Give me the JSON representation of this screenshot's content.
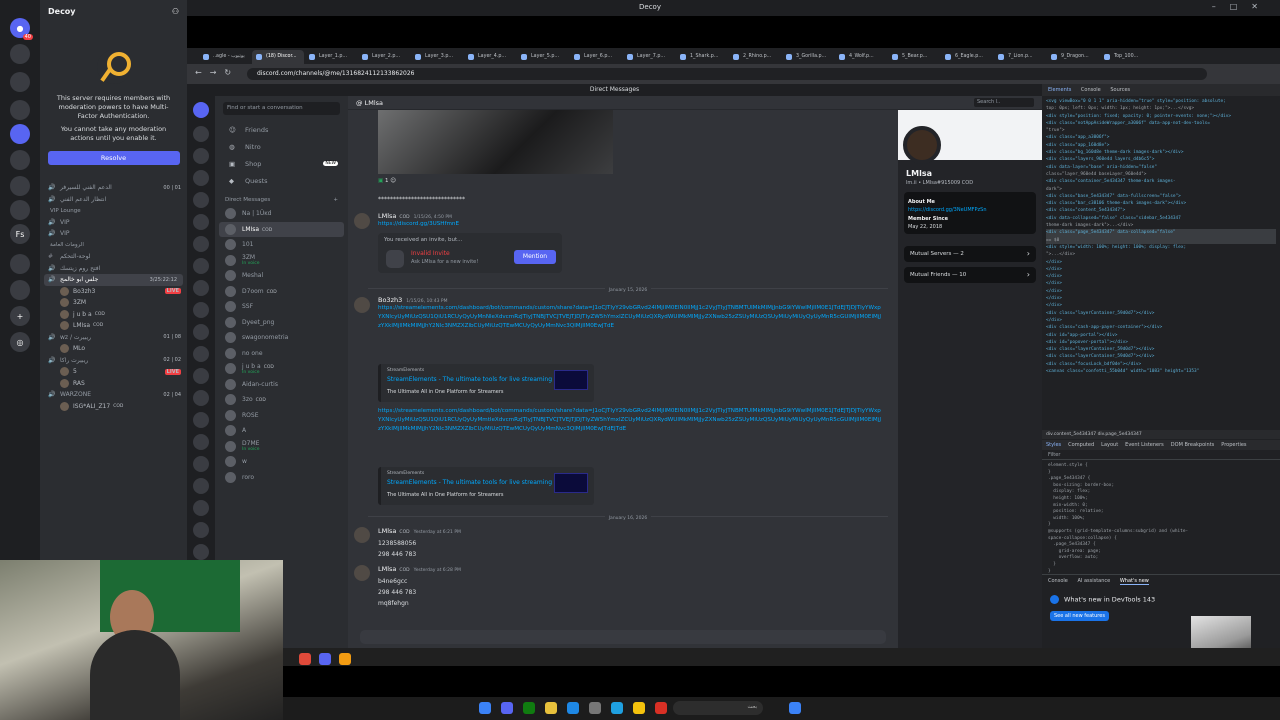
{
  "window": {
    "title": "Decoy"
  },
  "left": {
    "server_name": "Decoy",
    "mfa_text": "This server requires members with moderation powers to have Multi-Factor Authentication.",
    "mfa_text2": "You cannot take any moderation actions until you enable it.",
    "resolve": "Resolve",
    "channels": [
      {
        "label": "الدعم الفني للسيرفر",
        "counts": "00 | 01",
        "type": "voice"
      },
      {
        "label": "انتظار الدعم الفني",
        "type": "voice"
      },
      {
        "label": "VIP Lounge",
        "type": "category"
      },
      {
        "label": "VIP",
        "type": "voice"
      },
      {
        "label": "VIP",
        "type": "voice"
      },
      {
        "label": "الرومات العامة",
        "type": "category"
      },
      {
        "label": "لوحة-التحكم",
        "type": "text"
      },
      {
        "label": "افتح روم زيتسك",
        "type": "voice"
      },
      {
        "label": "جلس ابو خالمج",
        "counts": "3/25:22:12",
        "type": "voice-active"
      },
      {
        "label": "Bo3zh3",
        "type": "user",
        "badge": "LIVE"
      },
      {
        "label": "3ZM",
        "type": "user"
      },
      {
        "label": "j u b a",
        "type": "user",
        "tag": "COD"
      },
      {
        "label": "LMاsa",
        "type": "user",
        "tag": "COD"
      },
      {
        "label": "wz / ريبيرت",
        "counts": "01 | 08",
        "type": "voice"
      },
      {
        "label": "MLo",
        "type": "user"
      },
      {
        "label": "ريبيرت راكا",
        "counts": "02 | 02",
        "type": "voice"
      },
      {
        "label": "5",
        "type": "user",
        "badge": "LIVE"
      },
      {
        "label": "RAS",
        "type": "user"
      },
      {
        "label": "WARZONE",
        "counts": "02 | 04",
        "type": "voice"
      },
      {
        "label": "ISG*ALI_Z17",
        "type": "user",
        "tag": "COD"
      }
    ]
  },
  "browser": {
    "tabs": [
      "..agle - يوتيوب",
      "(18) Discor...",
      "Layer_1.p...",
      "Layer_2.p...",
      "Layer_3.p...",
      "Layer_4.p...",
      "Layer_5.p...",
      "Layer_6.p...",
      "Layer_7.p...",
      "1_Shark.p...",
      "2_Rhino.p...",
      "3_Gorilla.p...",
      "4_Wolf.p...",
      "5_Bear.p...",
      "6_Eagle.p...",
      "7_Lion.p...",
      "9_Dragon...",
      "Top_100..."
    ],
    "url": "discord.com/channels/@me/1316824112133862026"
  },
  "web": {
    "title": "Direct Messages",
    "find": "Find or start a conversation",
    "nav": [
      "Friends",
      "Nitro",
      "Shop",
      "Quests"
    ],
    "new_badge": "NEW",
    "dm_header": "Direct Messages",
    "dms": [
      {
        "name": "Na | 1Üĸd",
        "sub": ""
      },
      {
        "name": "LMاsa",
        "sub": "",
        "tag": "COD"
      },
      {
        "name": "101",
        "sub": ""
      },
      {
        "name": "3ZM",
        "sub": "In voice"
      },
      {
        "name": "Meshal",
        "sub": ""
      },
      {
        "name": "D7oom",
        "sub": "",
        "tag": "COD"
      },
      {
        "name": "SSF",
        "sub": ""
      },
      {
        "name": "Dyeet_png",
        "sub": ""
      },
      {
        "name": "swagonometria",
        "sub": ""
      },
      {
        "name": "no one",
        "sub": ""
      },
      {
        "name": "j u b a",
        "sub": "In voice",
        "tag": "COD"
      },
      {
        "name": "Aidan-curtis",
        "sub": ""
      },
      {
        "name": "3zo",
        "sub": "",
        "tag": "COD"
      },
      {
        "name": "ROSE",
        "sub": ""
      },
      {
        "name": "A",
        "sub": ""
      },
      {
        "name": "D7ME",
        "sub": "In voice"
      },
      {
        "name": "w",
        "sub": ""
      },
      {
        "name": "roro",
        "sub": ""
      }
    ],
    "chat": {
      "header": "LMاsa",
      "search": "Search l..",
      "reaction": "1",
      "hidden_line": "*****************************",
      "msg1": {
        "author": "LMاsa",
        "tag": "COD",
        "ts": "1/15/26, 4:50 PM",
        "link": "https://discord.gg/3USHfmnE"
      },
      "invite": {
        "header": "You received an invite, but...",
        "title": "Invalid Invite",
        "sub": "Ask LMاsa for a new invite!",
        "button": "Mention"
      },
      "date1": "January 15, 2026",
      "msg2": {
        "author": "Bo3zh3",
        "ts": "1/15/26, 10:43 PM",
        "link": "https://streamelements.com/dashboard/bot/commands/custom/share?data=J1oCJTIyY29vbGRvd24lMjIlM0ElN0IlMjJ1c2VyJTIyJTNBMTUlMkMlMjJnbG9iYWwlMjIlM0E1JTdEJTJDJTIyYWxpYXNlcyUyMiUzQSU1QiU1RCUyQyUyMnNleXdvcmRzJTIyJTNBJTVCJTVEJTJDJTIyZW5hYmxlZCUyMiUzQXRydWUlMkMlMjJyZXNwb25zZSUyMiUzQSUyMiUyMiUyQyUyMnR5cGUlMjIlM0ElMjJzYXklMjIlMkMlMjJhY2Nlc3NMZXZlbCUyMiUzQTEwMCUyQyUyMmNvc3QlMjIlM0EwJTdE"
      },
      "embed1": {
        "provider": "StreamElements",
        "title": "StreamElements - The ultimate tools for live streaming",
        "desc": "The Ultimate All in One Platform for Streamers"
      },
      "link3": "https://streamelements.com/dashboard/bot/commands/custom/share?data=J1oCJTIyY29vbGRvd24lMjIlM0ElN0IlMjJ1c2VyJTIyJTNBMTUlMkMlMjJnbG9iYWwlMjIlM0E1JTdEJTJDJTIyYWxpYXNlcyUyMiUzQSU1QiU1RCUyQyUyMmtleXdvcmRzJTIyJTNBJTVCJTVEJTJDJTIyZW5hYmxlZCUyMiUzQXRydWUlMkMlMjJyZXNwb25zZSUyMiUzQSUyMiUyMiUyQyUyMnR5cGUlMjIlM0ElMjJzYXklMjIlMkMlMjJhY2Nlc3NMZXZlbCUyMiUzQTEwMCUyQyUyMmNvc3QlMjIlM0EwJTdEJTdE",
      "embed2": {
        "provider": "StreamElements",
        "title": "StreamElements - The ultimate tools for live streaming",
        "desc": "The Ultimate All in One Platform for Streamers"
      },
      "date2": "January 16, 2026",
      "msg3": {
        "author": "LMاsa",
        "tag": "COD",
        "ts": "Yesterday at 6:21 PM",
        "lines": [
          "1238588056",
          "298 446 783"
        ]
      },
      "msg4": {
        "author": "LMاsa",
        "tag": "COD",
        "ts": "Yesterday at 6:28 PM",
        "lines": [
          "b4ne6gcc",
          "298 446 783",
          "mq8fehgn"
        ]
      }
    },
    "profile": {
      "name": "LMاsa",
      "tag": "lm.ii • LMاsa#915009",
      "cod": "COD",
      "about_label": "About Me",
      "about_link": "https://discord.gg/3NeUMFPzSn",
      "since_label": "Member Since",
      "since": "May 22, 2018",
      "mutual_servers": "Mutual Servers — 2",
      "mutual_friends": "Mutual Friends — 10"
    }
  },
  "devtools": {
    "tabs": [
      "Elements",
      "Console",
      "Sources"
    ],
    "code_lines": [
      "<svg viewBox=\"0 0 1 1\" aria-hidden=\"true\" style=\"position: absolute;",
      "  top: 0px; left: 0px; width: 1px; height: 1px;\">...</svg>",
      "<div style=\"position: fixed; opacity: 0; pointer-events: none;\"></div>",
      "<div class=\"notAppAsideWrapper_a3006f\" data-app-not-dev-tools=",
      "  \"true\">",
      "  <div class=\"app_a3006f\">",
      "    <div class=\"app_160d8e\">",
      "      <div class=\"bg_160d8e theme-dark images-dark\"></div>",
      "      <div class=\"layers_960e4d layers_d4b6c5\">",
      "        <div data-layer=\"base\" aria-hidden=\"false\"",
      "          class=\"layer_960e4d baseLayer_960e4d\">",
      "          <div class=\"container_5e434347 theme-dark images-",
      "            dark\">",
      "            <div class=\"base_5e434347\" data-fullscreen=\"false\">",
      "              <div class=\"bar_c38106 theme-dark images-dark\"></div>",
      "              <div class=\"content_5e434347\">",
      "                <div data-collapsed=\"false\" class=\"sidebar_5e434347",
      "                  theme-dark images-dark\">...</div>",
      "                <div class=\"page_5e434347\" data-collapsed=\"false\"",
      "                  == $0",
      "                <div style=\"width: 100%; height: 100%; display: flex;",
      "                  \">...</div>",
      "              </div>",
      "            </div>",
      "          </div>",
      "        </div>",
      "      </div>",
      "    </div>",
      "  </div>",
      "  <div class=\"layerContainer_59d0d7\"></div>",
      "</div>",
      "<div class=\"cash-app-payer-container\"></div>",
      "<div id=\"app-portal\"></div>",
      "<div id=\"popover-portal\"></div>",
      "<div class=\"layerContainer_59d0d7\"></div>",
      "<div class=\"layerContainer_59d0d7\"></div>",
      "<div class=\"focusLock_bdf0de\"></div>",
      "<canvas class=\"confetti_55b04d\" width=\"1083\" height=\"1353\""
    ],
    "breadcrumb": "div.content_5e434347   div.page_5e434347",
    "styles_tabs": [
      "Styles",
      "Computed",
      "Layout",
      "Event Listeners",
      "DOM Breakpoints",
      "Properties"
    ],
    "filter": "Filter",
    "styles_text": "element.style {\n}\n.page_5e434347 {\n  box-sizing: border-box;\n  display: flex;\n  height: 100%;\n  min-width: 0;\n  position: relative;\n  width: 100%;\n}\n@supports (grid-template-columns:subgrid) and (white-\nspace-collapse:collapse) {\n  .page_5e434347 {\n    grid-area: page;\n    overflow: auto;\n  }\n}",
    "drawer_tabs": [
      "Console",
      "AI assistance",
      "What's new"
    ],
    "whatsnew": "What's new in DevTools 143",
    "see_all": "See all new features"
  },
  "taskbar": {
    "search": "بحث"
  }
}
